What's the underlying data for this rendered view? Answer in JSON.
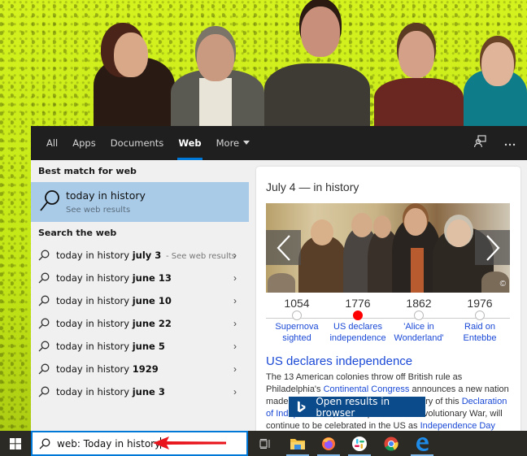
{
  "tabs": [
    {
      "label": "All",
      "active": false
    },
    {
      "label": "Apps",
      "active": false
    },
    {
      "label": "Documents",
      "active": false
    },
    {
      "label": "Web",
      "active": true
    },
    {
      "label": "More",
      "active": false,
      "has_caret": true
    }
  ],
  "tab_icons": {
    "feedback": "feedback-icon",
    "more_options": "ellipsis-icon"
  },
  "left_pane": {
    "best_match_heading": "Best match for web",
    "best_match": {
      "title": "today in history",
      "subtitle": "See web results",
      "icon": "search-icon"
    },
    "search_web_heading": "Search the web",
    "suggestions": [
      {
        "prefix": "today in history ",
        "bold": "july 3",
        "hint": "- See web results"
      },
      {
        "prefix": "today in history ",
        "bold": "june 13",
        "hint": ""
      },
      {
        "prefix": "today in history ",
        "bold": "june 10",
        "hint": ""
      },
      {
        "prefix": "today in history ",
        "bold": "june 22",
        "hint": ""
      },
      {
        "prefix": "today in history ",
        "bold": "june 5",
        "hint": ""
      },
      {
        "prefix": "today in history ",
        "bold": "1929",
        "hint": ""
      },
      {
        "prefix": "today in history ",
        "bold": "june 3",
        "hint": ""
      }
    ]
  },
  "card": {
    "title": "July 4 — in history",
    "copyright_symbol": "©",
    "timeline": [
      {
        "year": "1054",
        "label_line1": "Supernova",
        "label_line2": "sighted",
        "active": false
      },
      {
        "year": "1776",
        "label_line1": "US declares",
        "label_line2": "independence",
        "active": true
      },
      {
        "year": "1862",
        "label_line1": "'Alice in",
        "label_line2": "Wonderland'",
        "active": false
      },
      {
        "year": "1976",
        "label_line1": "Raid on",
        "label_line2": "Entebbe",
        "active": false
      }
    ],
    "headline": "US declares independence",
    "description": {
      "part1": "The 13 American colonies throw off British rule as Philadelphia's ",
      "link1": "Continental Congress",
      "part2": " announces a new nation made up of united states. The anniversary of this ",
      "link2": "Declaration of Independence",
      "part3": ", which sparked the Revolutionary War, will continue to be celebrated in the US as ",
      "link3": "Independence Day"
    }
  },
  "open_browser_button": {
    "label": "Open results in browser",
    "icon": "bing-icon"
  },
  "taskbar": {
    "search_value": "web: Today in history",
    "apps": [
      {
        "name": "file-explorer",
        "running": true
      },
      {
        "name": "firefox",
        "running": true
      },
      {
        "name": "slack",
        "running": true
      },
      {
        "name": "chrome",
        "running": false
      },
      {
        "name": "edge",
        "running": true
      }
    ]
  },
  "colors": {
    "accent": "#0078d7",
    "best_match_bg": "#a9cbe8",
    "link": "#1a49d6",
    "timeline_active": "#ff0000",
    "open_browser_bg": "#0b4a8b",
    "annotation_arrow": "#e8161c"
  }
}
